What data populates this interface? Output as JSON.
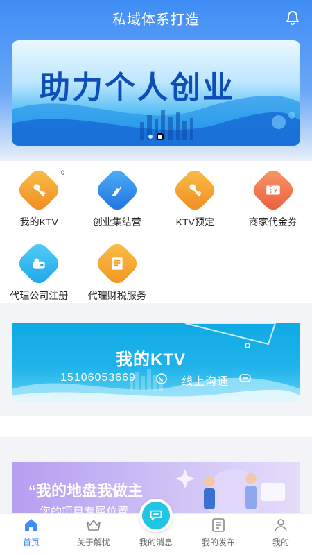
{
  "header": {
    "title": "私域体系打造"
  },
  "banner": {
    "text": "助力个人创业",
    "slides": 2,
    "active_slide": 1
  },
  "grid": {
    "items": [
      {
        "label": "我的KTV",
        "icon": "microphone-icon",
        "badge": "0",
        "color": "#f6a532"
      },
      {
        "label": "创业集结营",
        "icon": "rocket-icon",
        "badge": "",
        "color": "#2e8fe6"
      },
      {
        "label": "KTV预定",
        "icon": "microphone-icon",
        "badge": "",
        "color": "#f6a532"
      },
      {
        "label": "商家代金券",
        "icon": "voucher-icon",
        "badge": "",
        "color": "#f26a4b"
      },
      {
        "label": "代理公司注册",
        "icon": "company-register-icon",
        "badge": "",
        "color": "#27b7f0"
      },
      {
        "label": "代理财税服务",
        "icon": "tax-document-icon",
        "badge": "",
        "color": "#f6a532"
      }
    ]
  },
  "ktv_banner": {
    "title": "我的KTV",
    "phone": "15106053669",
    "chat": "线上沟通"
  },
  "promo": {
    "title": "“我的地盘我做主",
    "subtitle": "您的项目专属位置"
  },
  "tabbar": {
    "tabs": [
      {
        "label": "首页",
        "icon": "home-icon",
        "active": true
      },
      {
        "label": "关于解忧",
        "icon": "crown-icon",
        "active": false
      },
      {
        "label": "我的消息",
        "icon": "chat-bubble-icon",
        "active": false
      },
      {
        "label": "我的发布",
        "icon": "post-list-icon",
        "active": false
      },
      {
        "label": "我的",
        "icon": "user-icon",
        "active": false
      }
    ]
  },
  "colors": {
    "accent": "#3f8df5",
    "header_top": "#3f8df5",
    "center_button": "#20c4e4"
  }
}
